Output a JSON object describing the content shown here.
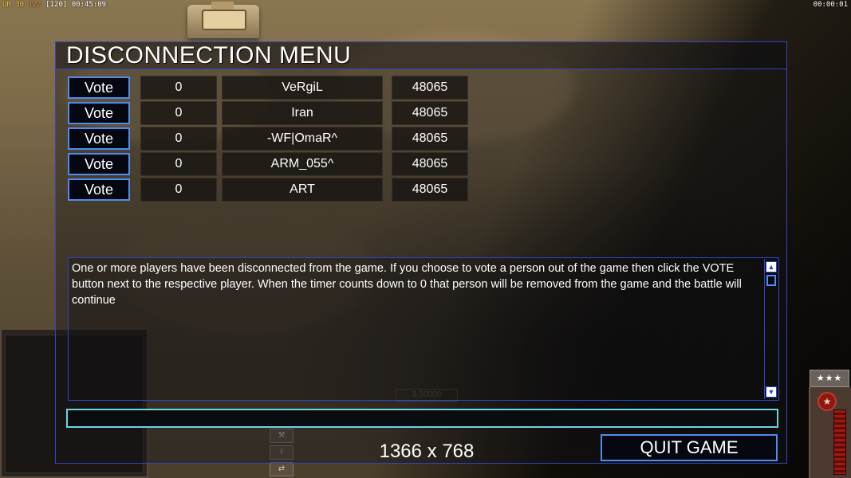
{
  "hud": {
    "top_left_prefix": "UR",
    "top_left_a": "30",
    "top_left_b": "124",
    "top_left_c": "[120]",
    "top_left_time": "00:45:09",
    "top_right_time": "00:00:01",
    "money_ghost": "$ 50000",
    "rank_stars": "★★★"
  },
  "dialog": {
    "title": "DISCONNECTION MENU",
    "players": [
      {
        "vote_label": "Vote",
        "count": "0",
        "name": "VeRgiL",
        "ping": "48065"
      },
      {
        "vote_label": "Vote",
        "count": "0",
        "name": "Iran",
        "ping": "48065"
      },
      {
        "vote_label": "Vote",
        "count": "0",
        "name": "-WF|OmaR^",
        "ping": "48065"
      },
      {
        "vote_label": "Vote",
        "count": "0",
        "name": "ARM_055^",
        "ping": "48065"
      },
      {
        "vote_label": "Vote",
        "count": "0",
        "name": "ART",
        "ping": "48065"
      }
    ],
    "message": "One or more players have been disconnected from the game. If you choose to vote a person out of the game then click the VOTE button next to the respective player. When the timer counts down to 0 that person will be removed from the game and the battle will continue",
    "chat_value": "",
    "resolution": "1366 x 768",
    "quit_label": "QUIT GAME"
  },
  "colors": {
    "frame": "#2e46c8",
    "button_border": "#4f8cf0",
    "input_border": "#6fd4e0"
  }
}
